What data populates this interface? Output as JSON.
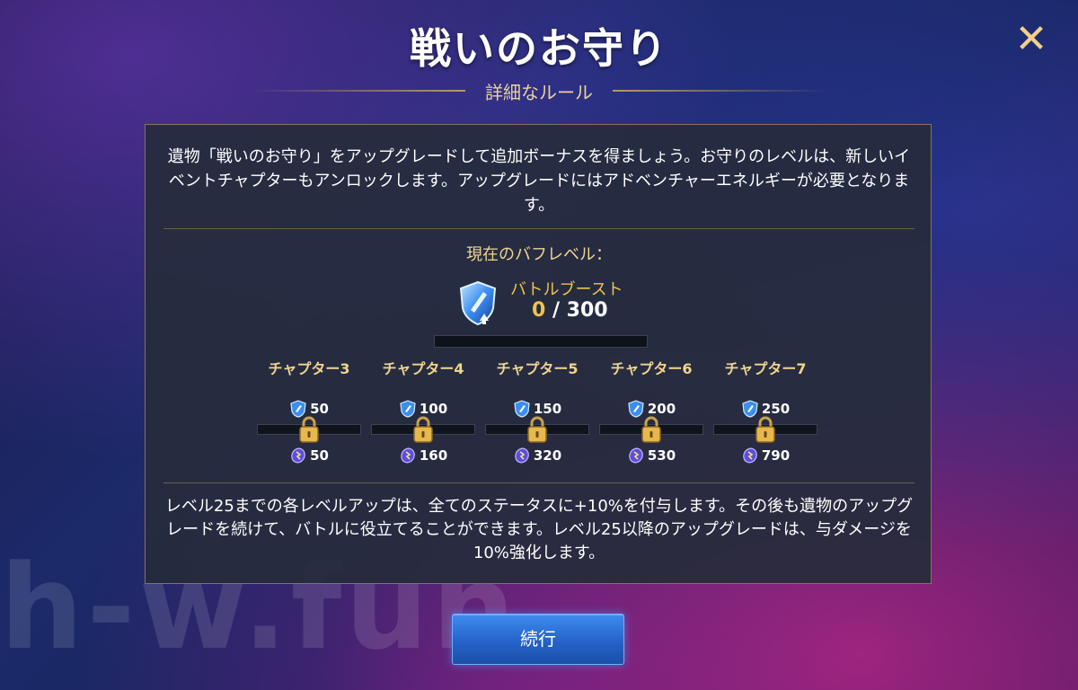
{
  "header": {
    "title": "戦いのお守り",
    "subtitle": "詳細なルール",
    "close_label": "✕"
  },
  "intro": "遺物「戦いのお守り」をアップグレードして追加ボーナスを得ましょう。お守りのレベルは、新しいイベントチャプターもアンロックします。アップグレードにはアドベンチャーエネルギーが必要となります。",
  "buff": {
    "label": "現在のバフレベル：",
    "name": "バトルブースト",
    "current": "0",
    "sep": " / ",
    "max": "300",
    "progress": 0
  },
  "chapters": [
    {
      "label": "チャプター3",
      "req": "50",
      "reward": "50",
      "locked": true
    },
    {
      "label": "チャプター4",
      "req": "100",
      "reward": "160",
      "locked": true
    },
    {
      "label": "チャプター5",
      "req": "150",
      "reward": "320",
      "locked": true
    },
    {
      "label": "チャプター6",
      "req": "200",
      "reward": "530",
      "locked": true
    },
    {
      "label": "チャプター7",
      "req": "250",
      "reward": "790",
      "locked": true
    }
  ],
  "footer": "レベル25までの各レベルアップは、全てのステータスに+10%を付与します。その後も遺物のアップグレードを続けて、バトルに役立てることができます。レベル25以降のアップグレードは、与ダメージを10%強化します。",
  "watermark": "h-w.fun",
  "continue_label": "続行",
  "colors": {
    "gold": "#f0c24a",
    "accent_blue": "#2f74dd",
    "panel": "#262c3c"
  }
}
